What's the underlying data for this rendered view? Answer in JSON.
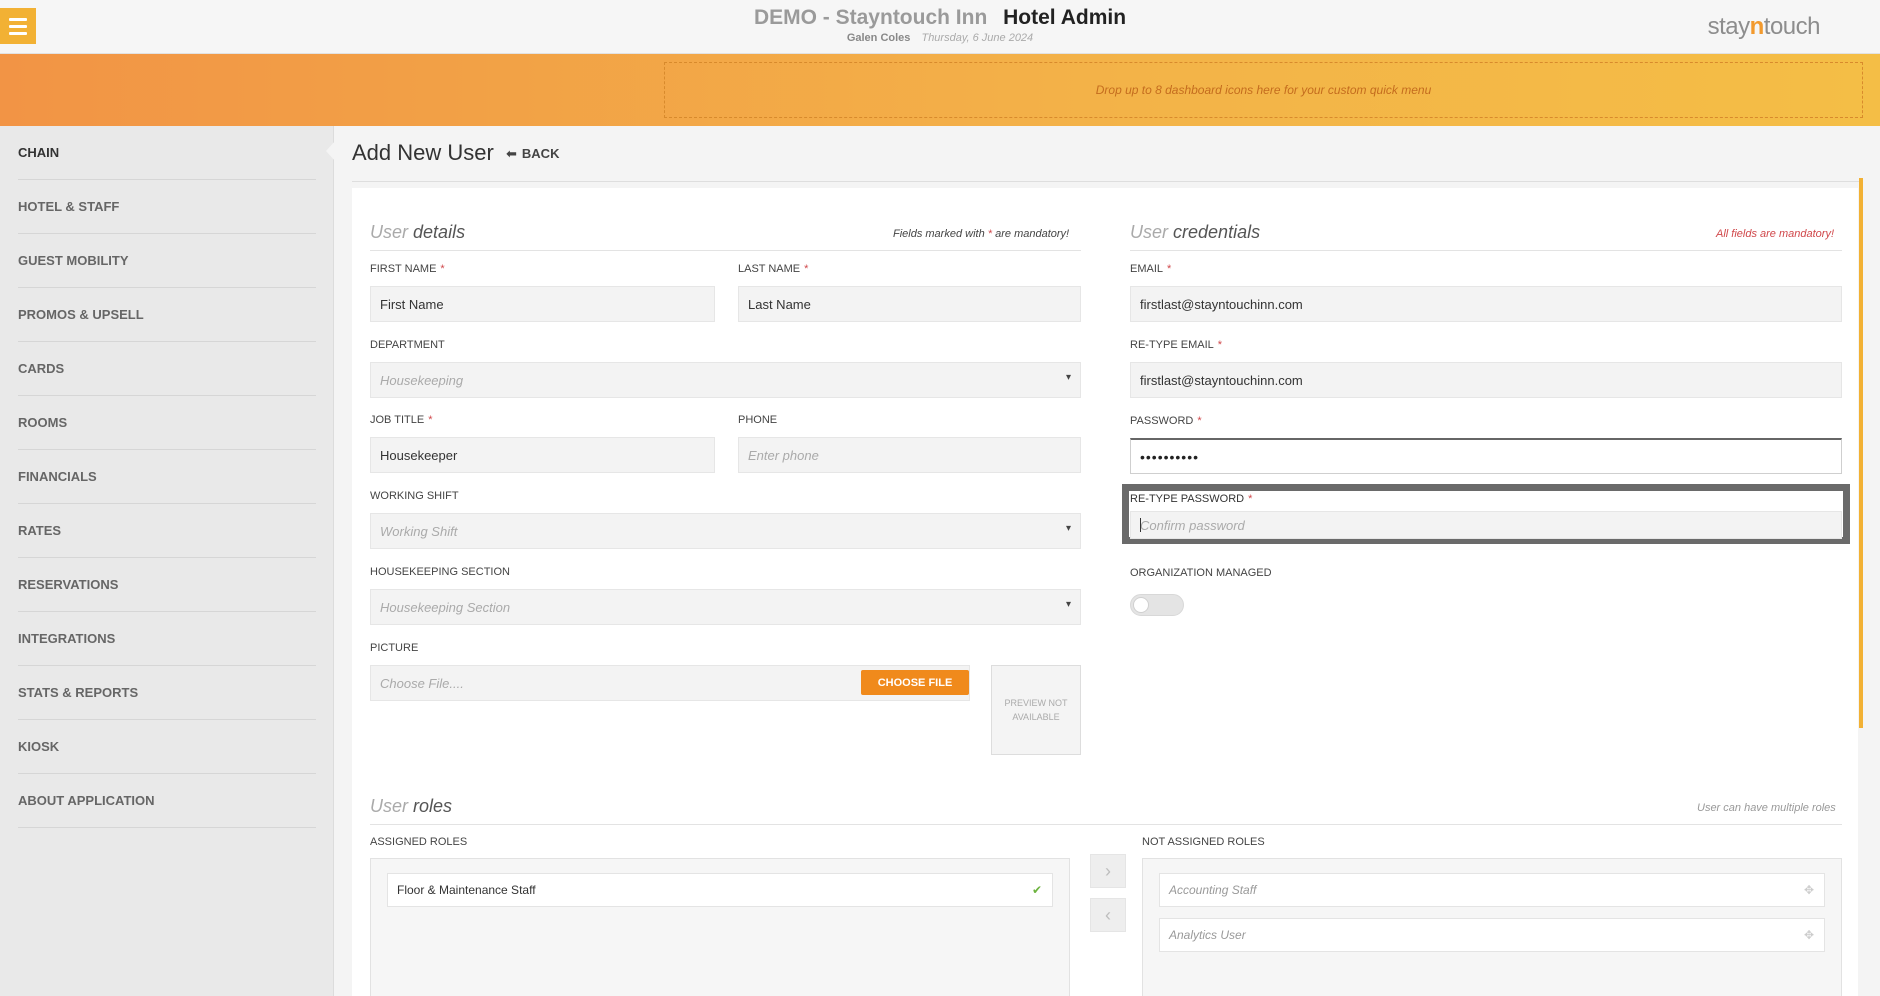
{
  "header": {
    "property_name": "DEMO - Stayntouch Inn",
    "app_title": "Hotel Admin",
    "user_name": "Galen Coles",
    "date": "Thursday, 6 June 2024",
    "logo_left": "stay",
    "logo_mid": "n",
    "logo_right": "touch"
  },
  "dashboard": {
    "dropzone_text": "Drop up to 8 dashboard icons here for your custom quick menu"
  },
  "sidebar": {
    "items": [
      {
        "label": "CHAIN"
      },
      {
        "label": "HOTEL & STAFF"
      },
      {
        "label": "GUEST MOBILITY"
      },
      {
        "label": "PROMOS & UPSELL"
      },
      {
        "label": "CARDS"
      },
      {
        "label": "ROOMS"
      },
      {
        "label": "FINANCIALS"
      },
      {
        "label": "RATES"
      },
      {
        "label": "RESERVATIONS"
      },
      {
        "label": "INTEGRATIONS"
      },
      {
        "label": "STATS & REPORTS"
      },
      {
        "label": "KIOSK"
      },
      {
        "label": "ABOUT APPLICATION"
      }
    ]
  },
  "page": {
    "title": "Add New User",
    "back_label": "BACK"
  },
  "user_details": {
    "title_light": "User",
    "title_main": "details",
    "note_pre": "Fields marked with",
    "note_star": "*",
    "note_post": "are mandatory!",
    "first_name": {
      "label": "FIRST NAME",
      "value": "First Name"
    },
    "last_name": {
      "label": "LAST NAME",
      "value": "Last Name"
    },
    "department": {
      "label": "DEPARTMENT",
      "value": "Housekeeping"
    },
    "job_title": {
      "label": "JOB TITLE",
      "value": "Housekeeper"
    },
    "phone": {
      "label": "PHONE",
      "placeholder": "Enter phone"
    },
    "working_shift": {
      "label": "WORKING SHIFT",
      "placeholder": "Working Shift"
    },
    "housekeeping_section": {
      "label": "HOUSEKEEPING SECTION",
      "placeholder": "Housekeeping Section"
    },
    "picture": {
      "label": "PICTURE",
      "placeholder": "Choose File....",
      "button": "CHOOSE FILE",
      "preview": "PREVIEW NOT AVAILABLE"
    }
  },
  "credentials": {
    "title_light": "User",
    "title_main": "credentials",
    "note": "All fields are mandatory!",
    "email": {
      "label": "EMAIL",
      "value": "firstlast@stayntouchinn.com"
    },
    "retype_email": {
      "label": "RE-TYPE EMAIL",
      "value": "firstlast@stayntouchinn.com"
    },
    "password": {
      "label": "PASSWORD",
      "value": "••••••••••"
    },
    "retype_password": {
      "label": "RE-TYPE PASSWORD",
      "placeholder": "Confirm password"
    },
    "org_managed": {
      "label": "ORGANIZATION MANAGED",
      "on": false
    }
  },
  "roles": {
    "title_light": "User",
    "title_main": "roles",
    "note": "User can have multiple roles",
    "assigned_label": "ASSIGNED ROLES",
    "not_assigned_label": "NOT ASSIGNED ROLES",
    "assigned": [
      "Floor & Maintenance Staff"
    ],
    "not_assigned": [
      "Accounting Staff",
      "Analytics User"
    ]
  },
  "colors": {
    "accent": "#f2b134",
    "button": "#f08a1c",
    "required": "#d0474a",
    "check": "#6cb33e"
  }
}
